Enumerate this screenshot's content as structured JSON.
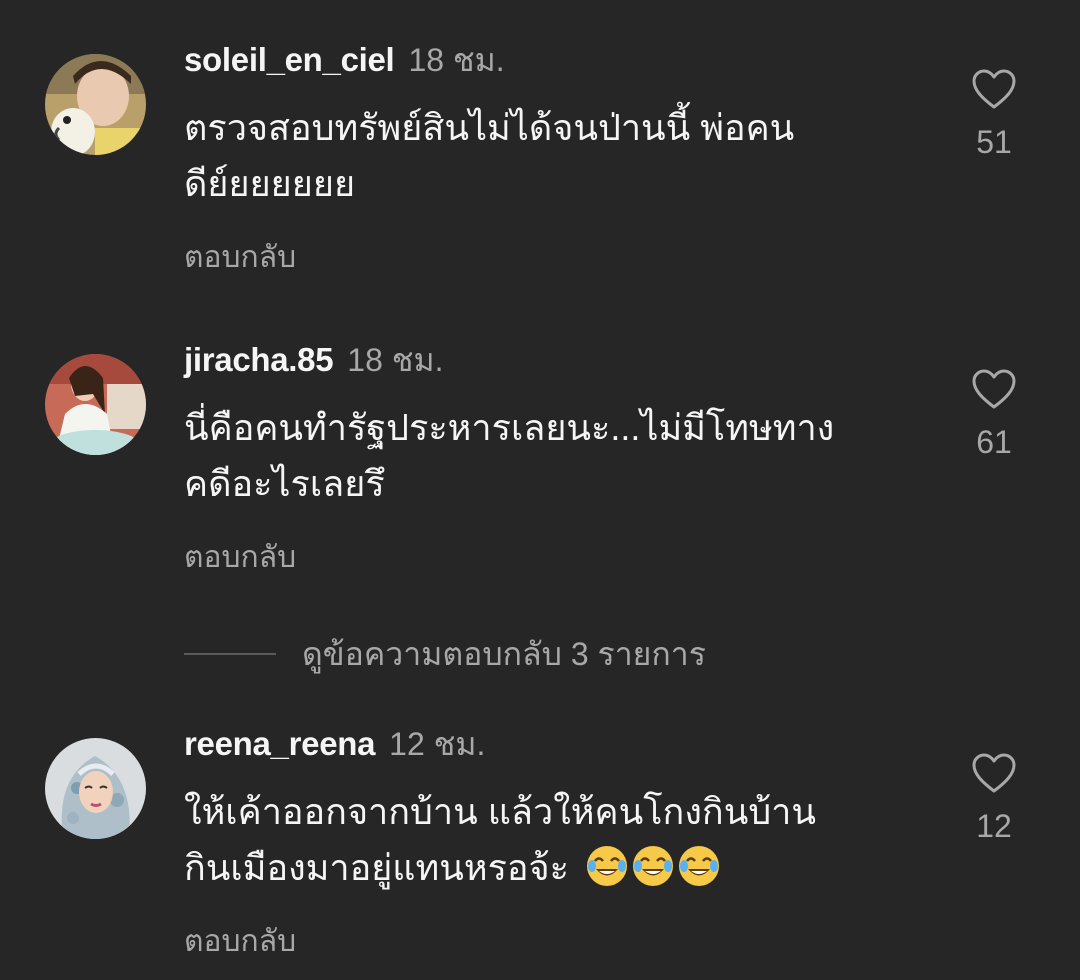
{
  "comments": [
    {
      "username": "soleil_en_ciel",
      "time": "18 ชม.",
      "text_lines": [
        "ตรวจสอบทรัพย์สินไม่ได้จนป่านนี้ พ่อคน",
        "ดีย์ยยยยยย"
      ],
      "reply_label": "ตอบกลับ",
      "likes": "51",
      "avatar_icon": "avatar-photo-woman-with-cockatoo"
    },
    {
      "username": "jiracha.85",
      "time": "18 ชม.",
      "text_lines": [
        "นี่คือคนทำรัฐประหารเลยนะ...ไม่มีโทษทาง",
        "คดีอะไรเลยรึ"
      ],
      "reply_label": "ตอบกลับ",
      "likes": "61",
      "avatar_icon": "avatar-photo-woman-in-white-dress"
    },
    {
      "username": "reena_reena",
      "time": "12 ชม.",
      "text_lines": [
        "ให้เค้าออกจากบ้าน แล้วให้คนโกงกินบ้าน",
        "กินเมืองมาอยู่แทนหรอจ้ะ"
      ],
      "emoji": [
        "😂",
        "😂",
        "😂"
      ],
      "reply_label": "ตอบกลับ",
      "likes": "12",
      "avatar_icon": "avatar-photo-woman-in-hijab"
    }
  ],
  "view_replies": {
    "label": "ดูข้อความตอบกลับ 3 รายการ"
  },
  "icons": {
    "like": "heart-outline-icon",
    "emoji": "face-with-tears-of-joy-emoji"
  },
  "colors": {
    "background": "#262626",
    "primary_text": "#f5f5f5",
    "secondary_text": "#a8a8a8",
    "divider": "#5a5a5a"
  }
}
